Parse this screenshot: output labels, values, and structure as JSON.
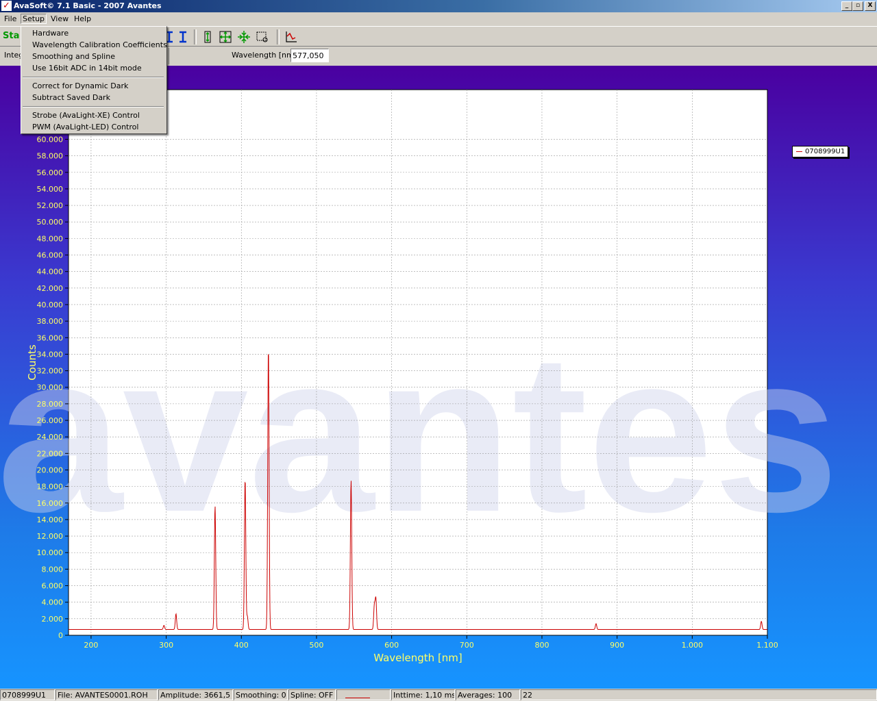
{
  "window": {
    "title": "AvaSoft© 7.1 Basic - 2007 Avantes",
    "min_label": "_",
    "max_label": "▫",
    "close_label": "X"
  },
  "menubar": {
    "file": "File",
    "setup": "Setup",
    "view": "View",
    "help": "Help"
  },
  "toolbar": {
    "start_label": "Sta"
  },
  "params": {
    "integration_label": "Integ",
    "wavelength_label": "Wavelength [nm]:",
    "wavelength_value": "577,050"
  },
  "setup_menu": {
    "hardware": "Hardware",
    "wavelength_calibration": "Wavelength Calibration Coefficients",
    "smoothing": "Smoothing and Spline",
    "adc_mode": "Use 16bit ADC in 14bit mode",
    "dynamic_dark": "Correct for Dynamic Dark",
    "subtract_dark": "Subtract Saved Dark",
    "strobe": "Strobe (AvaLight-XE) Control",
    "pwm": "PWM (AvaLight-LED) Control"
  },
  "legend": {
    "label": "0708999U1"
  },
  "watermark": "avantes",
  "chart_data": {
    "type": "line",
    "xlabel": "Wavelength [nm]",
    "ylabel": "Counts",
    "xlim": [
      170,
      1100
    ],
    "ylim": [
      0,
      66000
    ],
    "x_ticks": [
      200,
      300,
      400,
      500,
      600,
      700,
      800,
      900,
      1000,
      1100
    ],
    "x_tick_labels": [
      "200",
      "300",
      "400",
      "500",
      "600",
      "700",
      "800",
      "900",
      "1.000",
      "1.100"
    ],
    "y_ticks": [
      0,
      2000,
      4000,
      6000,
      8000,
      10000,
      12000,
      14000,
      16000,
      18000,
      20000,
      22000,
      24000,
      26000,
      28000,
      30000,
      32000,
      34000,
      36000,
      38000,
      40000,
      42000,
      44000,
      46000,
      48000,
      50000,
      52000,
      54000,
      56000,
      58000,
      60000
    ],
    "y_tick_labels": [
      "0",
      "2.000",
      "4.000",
      "6.000",
      "8.000",
      "10.000",
      "12.000",
      "14.000",
      "16.000",
      "18.000",
      "20.000",
      "22.000",
      "24.000",
      "26.000",
      "28.000",
      "30.000",
      "32.000",
      "34.000",
      "36.000",
      "38.000",
      "40.000",
      "42.000",
      "44.000",
      "46.000",
      "48.000",
      "50.000",
      "52.000",
      "54.000",
      "56.000",
      "58.000",
      "60.000"
    ],
    "grid": true,
    "legend_position": "right",
    "series": [
      {
        "name": "0708999U1",
        "color": "#cc0000",
        "baseline": 700,
        "peaks": [
          {
            "x": 297,
            "y": 1200
          },
          {
            "x": 313,
            "y": 2600
          },
          {
            "x": 365,
            "y": 15700
          },
          {
            "x": 405,
            "y": 19000
          },
          {
            "x": 408,
            "y": 2300
          },
          {
            "x": 436,
            "y": 35000
          },
          {
            "x": 546,
            "y": 18800
          },
          {
            "x": 577,
            "y": 3600
          },
          {
            "x": 579,
            "y": 4400
          },
          {
            "x": 872,
            "y": 1400
          },
          {
            "x": 1092,
            "y": 1700
          }
        ]
      }
    ]
  },
  "statusbar": {
    "spectrometer": "0708999U1",
    "file": "File: AVANTES0001.ROH",
    "amplitude": "Amplitude: 3661,5",
    "smoothing": "Smoothing: 0",
    "spline": "Spline: OFF",
    "inttime": "Inttime: 1,10 ms",
    "averages": "Averages: 100",
    "extra": "22"
  }
}
